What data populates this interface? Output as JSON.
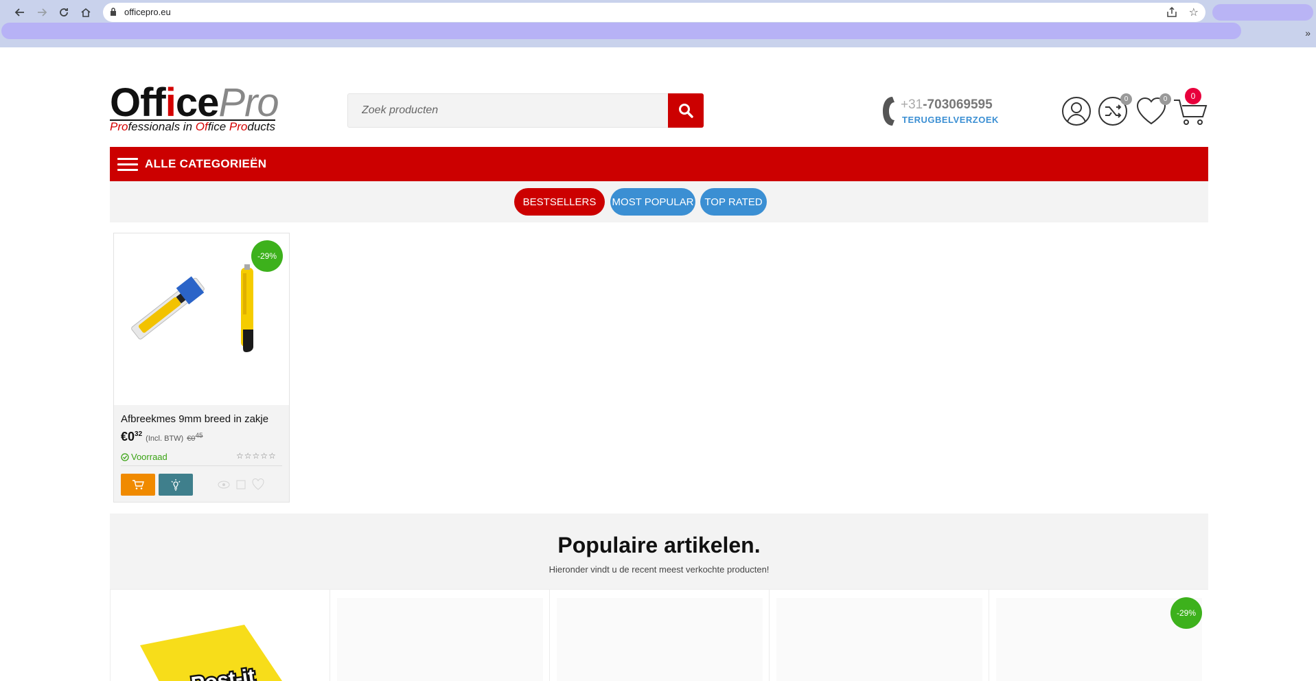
{
  "browser": {
    "url": "officepro.eu",
    "more": "»"
  },
  "header": {
    "logo": {
      "office_o": "Off",
      "office_i": "i",
      "office_ce": "ce",
      "pro": "Pro",
      "tag_pro": "Pro",
      "tag_rest1": "fessionals in ",
      "tag_office": "Of",
      "tag_rest2": "fice ",
      "tag_pro2": "Pro",
      "tag_rest3": "ducts"
    },
    "search": {
      "placeholder": "Zoek producten"
    },
    "phone": {
      "country_code": "+31",
      "number": "-703069595",
      "callback": "TERUGBELVERZOEK"
    },
    "compare_count": "0",
    "wishlist_count": "0",
    "cart_count": "0"
  },
  "category_bar": {
    "label": "ALLE CATEGORIEËN"
  },
  "tabs": [
    {
      "label": "BESTSELLERS",
      "active": true
    },
    {
      "label": "MOST POPULAR",
      "active": false
    },
    {
      "label": "TOP RATED",
      "active": false
    }
  ],
  "product": {
    "discount": "-29%",
    "title": "Afbreekmes 9mm breed in zakje",
    "price_main": "€0",
    "price_cents": "32",
    "vat": "(Incl. BTW)",
    "old_price_main": "€0",
    "old_price_cents": "45",
    "stock": "Voorraad",
    "rating_stars": "☆☆☆☆☆"
  },
  "popular": {
    "title": "Populaire artikelen.",
    "subtitle": "Hieronder vindt u de recent meest verkochte producten!",
    "discount": "-29%"
  },
  "colors": {
    "brand_red": "#cc0000",
    "tab_blue": "#3b8fd3",
    "discount_green": "#3db11c",
    "cart_orange": "#f08a00",
    "info_teal": "#3f7f8c",
    "cart_badge": "#e8003c"
  }
}
